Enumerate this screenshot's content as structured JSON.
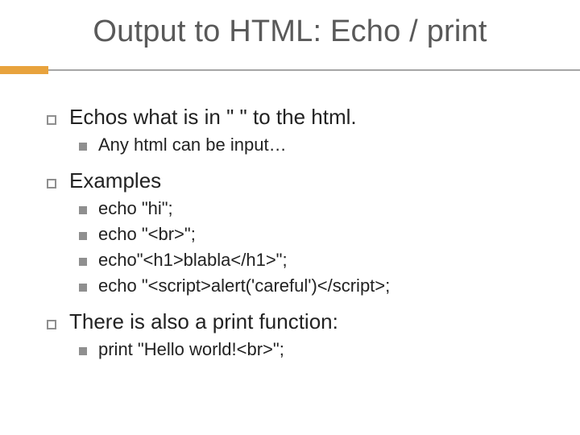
{
  "title": "Output to HTML: Echo / print",
  "bullets": {
    "b1": {
      "text": "Echos what is in \" \" to the html."
    },
    "b1s1": {
      "text": "Any html can be input…"
    },
    "b2": {
      "text": "Examples"
    },
    "b2s1": {
      "text": "echo \"hi\";"
    },
    "b2s2": {
      "text": "echo \"<br>\";"
    },
    "b2s3": {
      "text": "echo\"<h1>blabla</h1>\";"
    },
    "b2s4": {
      "text": "echo \"<script>alert('careful')</script>;"
    },
    "b3": {
      "text": "There is also a print function:"
    },
    "b3s1": {
      "text": "print \"Hello world!<br>\";"
    }
  }
}
